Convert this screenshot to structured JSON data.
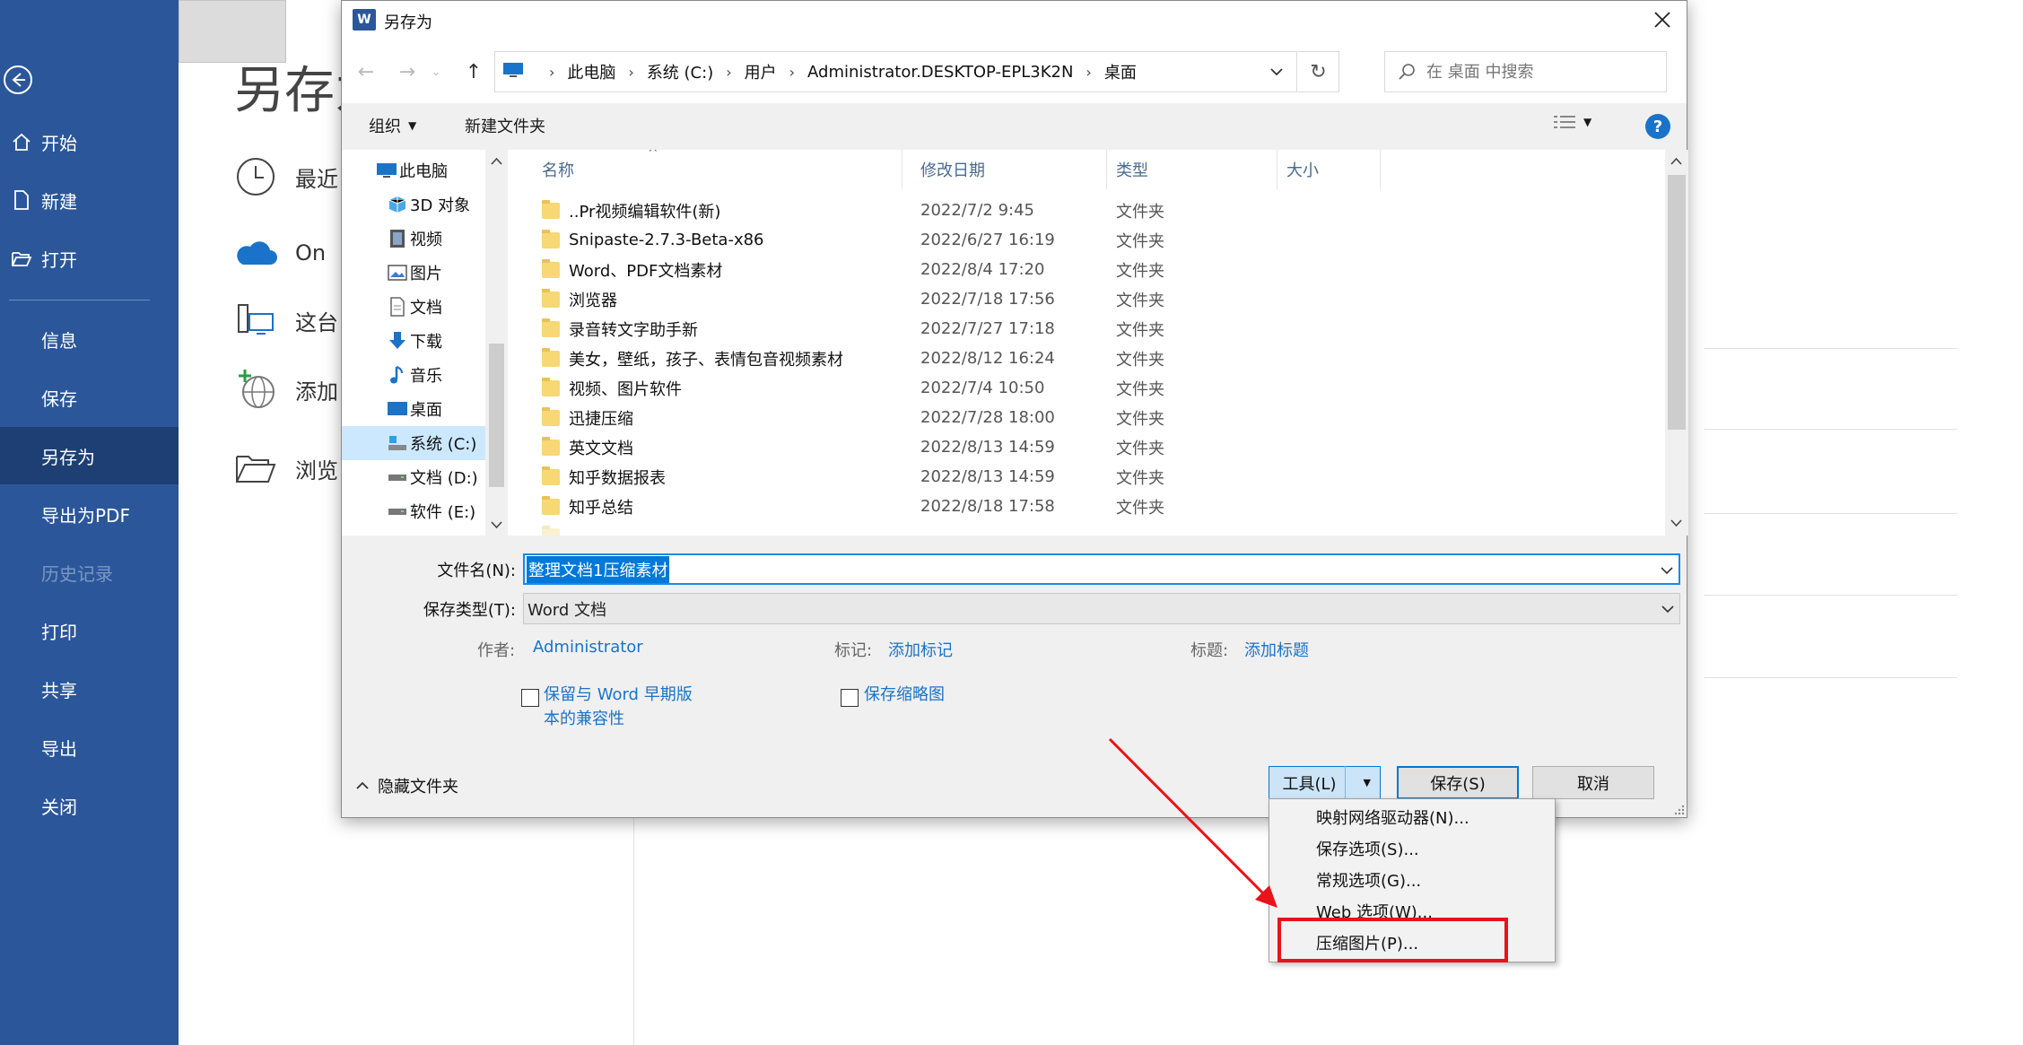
{
  "backstage": {
    "nav": [
      {
        "label": "开始"
      },
      {
        "label": "新建"
      },
      {
        "label": "打开"
      },
      {
        "label": "信息"
      },
      {
        "label": "保存"
      },
      {
        "label": "另存为"
      },
      {
        "label": "导出为PDF"
      },
      {
        "label": "历史记录"
      },
      {
        "label": "打印"
      },
      {
        "label": "共享"
      },
      {
        "label": "导出"
      },
      {
        "label": "关闭"
      }
    ],
    "title": "另存为",
    "locations": [
      {
        "label": "最近"
      },
      {
        "label": "On"
      },
      {
        "label": "这台"
      },
      {
        "label": "添加"
      },
      {
        "label": "浏览"
      }
    ]
  },
  "dialog": {
    "title": "另存为",
    "breadcrumb": [
      "此电脑",
      "系统 (C:)",
      "用户",
      "Administrator.DESKTOP-EPL3K2N",
      "桌面"
    ],
    "search_placeholder": "在 桌面 中搜索",
    "toolbar": {
      "organize": "组织",
      "new_folder": "新建文件夹"
    },
    "tree": [
      {
        "label": "此电脑",
        "icon": "pc-icon"
      },
      {
        "label": "3D 对象",
        "icon": "3d-objects-icon"
      },
      {
        "label": "视频",
        "icon": "video-icon"
      },
      {
        "label": "图片",
        "icon": "pictures-icon"
      },
      {
        "label": "文档",
        "icon": "documents-icon"
      },
      {
        "label": "下载",
        "icon": "download-icon"
      },
      {
        "label": "音乐",
        "icon": "music-icon"
      },
      {
        "label": "桌面",
        "icon": "desktop-icon"
      },
      {
        "label": "系统 (C:)",
        "icon": "drive-c-icon"
      },
      {
        "label": "文档 (D:)",
        "icon": "drive-d-icon"
      },
      {
        "label": "软件 (E:)",
        "icon": "drive-e-icon"
      }
    ],
    "columns": {
      "name": "名称",
      "date": "修改日期",
      "type": "类型",
      "size": "大小"
    },
    "files": [
      {
        "name": "..Pr视频编辑软件(新)",
        "date": "2022/7/2 9:45",
        "type": "文件夹"
      },
      {
        "name": "Snipaste-2.7.3-Beta-x86",
        "date": "2022/6/27 16:19",
        "type": "文件夹"
      },
      {
        "name": "Word、PDF文档素材",
        "date": "2022/8/4 17:20",
        "type": "文件夹"
      },
      {
        "name": "浏览器",
        "date": "2022/7/18 17:56",
        "type": "文件夹"
      },
      {
        "name": "录音转文字助手新",
        "date": "2022/7/27 17:18",
        "type": "文件夹"
      },
      {
        "name": "美女，壁纸，孩子、表情包音视频素材",
        "date": "2022/8/12 16:24",
        "type": "文件夹"
      },
      {
        "name": "视频、图片软件",
        "date": "2022/7/4 10:50",
        "type": "文件夹"
      },
      {
        "name": "迅捷压缩",
        "date": "2022/7/28 18:00",
        "type": "文件夹"
      },
      {
        "name": "英文文档",
        "date": "2022/8/13 14:59",
        "type": "文件夹"
      },
      {
        "name": "知乎数据报表",
        "date": "2022/8/13 14:59",
        "type": "文件夹"
      },
      {
        "name": "知乎总结",
        "date": "2022/8/18 17:58",
        "type": "文件夹"
      }
    ],
    "filename_label": "文件名(N):",
    "filename_value": "整理文档1压缩素材",
    "filetype_label": "保存类型(T):",
    "filetype_value": "Word 文档",
    "meta": {
      "author_label": "作者:",
      "author_value": "Administrator",
      "tags_label": "标记:",
      "tags_value": "添加标记",
      "title_label": "标题:",
      "title_value": "添加标题"
    },
    "compat_line1": "保留与 Word 早期版",
    "compat_line2": "本的兼容性",
    "thumbnail_label": "保存缩略图",
    "hide_folders": "隐藏文件夹",
    "tools_label": "工具(L)",
    "save_label": "保存(S)",
    "cancel_label": "取消"
  },
  "tools_menu": [
    {
      "label": "映射网络驱动器(N)..."
    },
    {
      "label": "保存选项(S)..."
    },
    {
      "label": "常规选项(G)..."
    },
    {
      "label": "Web 选项(W)..."
    },
    {
      "label": "压缩图片(P)..."
    }
  ],
  "colors": {
    "word_blue": "#2b579a",
    "nav_active": "#1d3f73",
    "annotation_red": "#e8131b",
    "link_blue": "#1a73c8"
  }
}
